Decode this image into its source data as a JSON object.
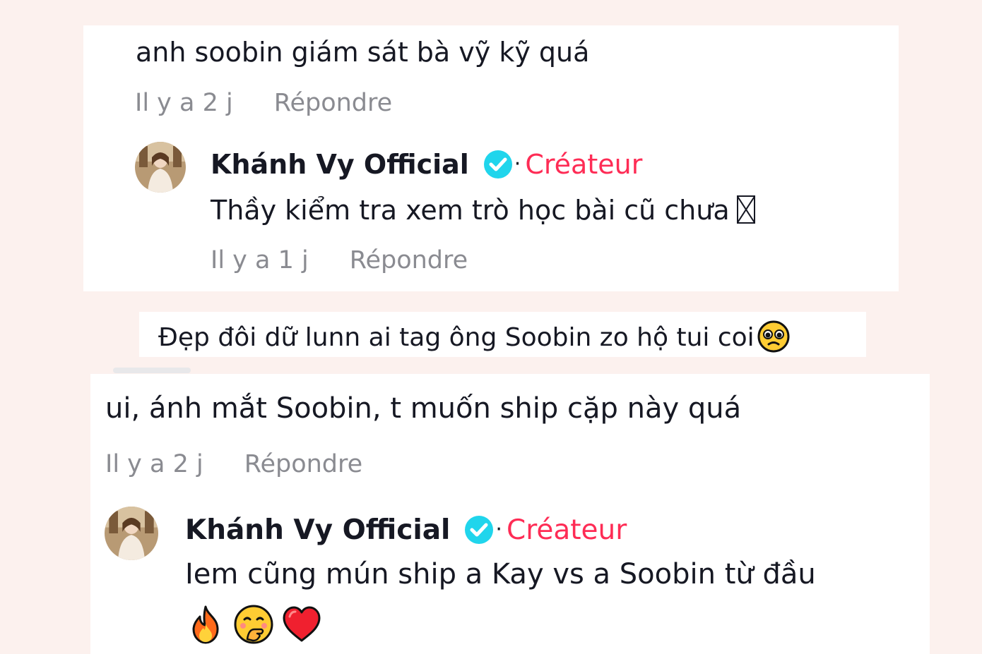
{
  "thread1": {
    "comment": {
      "text": "anh soobin giám sát bà vỹ kỹ quá",
      "time": "Il y a 2 j",
      "reply_label": "Répondre"
    },
    "reply": {
      "author": "Khánh Vy Official",
      "dot": "·",
      "role": "Créateur",
      "text": "Thầy kiểm tra xem trò học bài cũ chưa",
      "time": "Il y a 1 j",
      "reply_label": "Répondre"
    }
  },
  "caption": {
    "text": "Đẹp đôi dữ lunn ai tag ông Soobin zo hộ tui coi",
    "emoji": "pleading-face-icon"
  },
  "thread2": {
    "comment": {
      "text": "ui, ánh mắt Soobin, t muốn ship cặp này quá",
      "time": "Il y a 2 j",
      "reply_label": "Répondre"
    },
    "reply": {
      "author": "Khánh Vy Official",
      "dot": "·",
      "role": "Créateur",
      "text": "Iem cũng mún ship a Kay vs a Soobin từ đầu",
      "time": "",
      "reply_label": "",
      "emojis": [
        "fire-icon",
        "hand-over-mouth-face-icon",
        "red-heart-icon"
      ]
    }
  },
  "colors": {
    "background": "#fcf1ee",
    "card": "#ffffff",
    "text": "#161823",
    "muted": "#8a8b91",
    "creator": "#fe2c55",
    "verified": "#20d5ec"
  }
}
